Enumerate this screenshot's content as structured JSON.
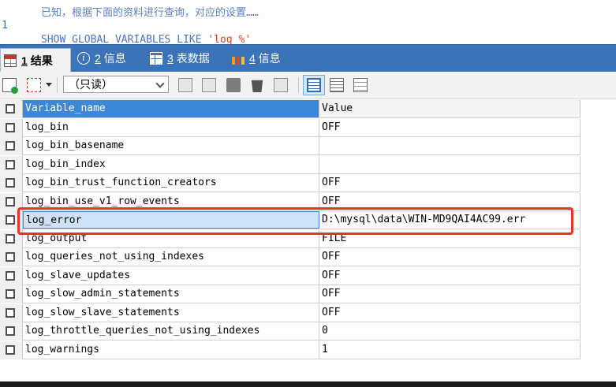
{
  "editor": {
    "prev_line_text": "已知，根据下面的资料进行查询，对应的设置……",
    "line_number": "1",
    "kw_show": "SHOW",
    "kw_global": "GLOBAL",
    "kw_variables": "VARIABLES",
    "kw_like": "LIKE",
    "pattern": "'log_%'"
  },
  "tabs": [
    {
      "num": "1",
      "label": "结果",
      "icon": "grid-icon",
      "active": true
    },
    {
      "num": "2",
      "label": "信息",
      "icon": "info-icon",
      "active": false
    },
    {
      "num": "3",
      "label": "表数据",
      "icon": "table-icon",
      "active": false
    },
    {
      "num": "4",
      "label": "信息",
      "icon": "bars-icon",
      "active": false
    }
  ],
  "toolbar": {
    "mode_select": "（只读）"
  },
  "grid": {
    "headers": [
      "Variable_name",
      "Value"
    ],
    "rows": [
      [
        "log_bin",
        "OFF"
      ],
      [
        "log_bin_basename",
        ""
      ],
      [
        "log_bin_index",
        ""
      ],
      [
        "log_bin_trust_function_creators",
        "OFF"
      ],
      [
        "log_bin_use_v1_row_events",
        "OFF"
      ],
      [
        "log_error",
        "D:\\mysql\\data\\WIN-MD9QAI4AC99.err"
      ],
      [
        "log_output",
        "FILE"
      ],
      [
        "log_queries_not_using_indexes",
        "OFF"
      ],
      [
        "log_slave_updates",
        "OFF"
      ],
      [
        "log_slow_admin_statements",
        "OFF"
      ],
      [
        "log_slow_slave_statements",
        "OFF"
      ],
      [
        "log_throttle_queries_not_using_indexes",
        "0"
      ],
      [
        "log_warnings",
        "1"
      ]
    ]
  },
  "colors": {
    "tab_bar": "#3b73b9",
    "header_selected": "#3c87d8",
    "highlight": "#e8332c"
  }
}
